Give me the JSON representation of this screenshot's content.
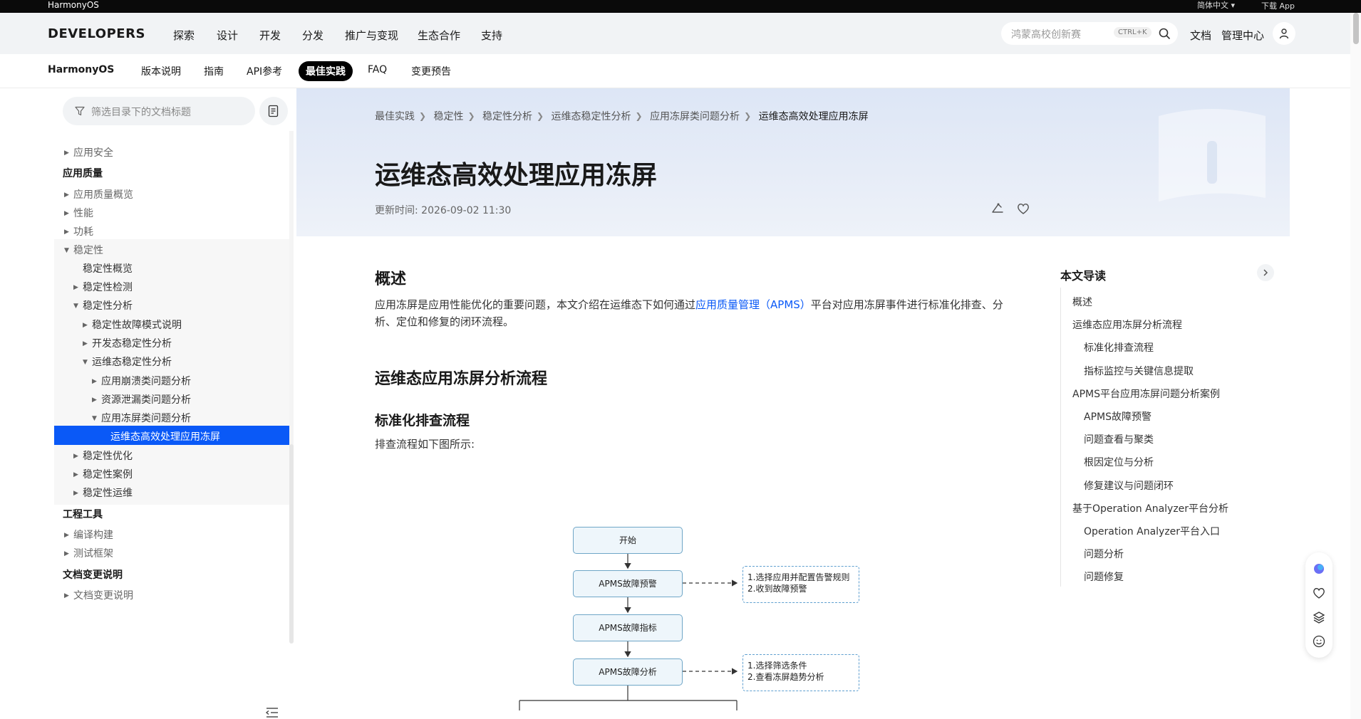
{
  "topbar": {
    "brand": "HarmonyOS",
    "language": "简体中文 ▾",
    "download": "下载 App"
  },
  "nav": {
    "logo": "DEVELOPERS",
    "items": [
      "探索",
      "设计",
      "开发",
      "分发",
      "推广与变现",
      "生态合作",
      "支持"
    ],
    "search": {
      "placeholder": "鸿蒙高校创新赛",
      "shortcut": "CTRL+K"
    },
    "right_links": [
      "文档",
      "管理中心"
    ]
  },
  "subnav": {
    "product": "HarmonyOS",
    "tabs": [
      "版本说明",
      "指南",
      "API参考",
      "最佳实践",
      "FAQ",
      "变更预告"
    ],
    "active_tab": "最佳实践"
  },
  "sidebar": {
    "filter_placeholder": "筛选目录下的文档标题",
    "items": [
      {
        "label": "应用安全",
        "type": "collapsed"
      },
      {
        "label": "应用质量",
        "type": "heading"
      },
      {
        "label": "应用质量概览",
        "type": "collapsed"
      },
      {
        "label": "性能",
        "type": "collapsed"
      },
      {
        "label": "功耗",
        "type": "collapsed"
      },
      {
        "label": "稳定性",
        "type": "expanded"
      },
      {
        "label": "稳定性概览",
        "type": "leaf"
      },
      {
        "label": "稳定性检测",
        "type": "collapsed"
      },
      {
        "label": "稳定性分析",
        "type": "expanded"
      },
      {
        "label": "稳定性故障模式说明",
        "type": "collapsed"
      },
      {
        "label": "开发态稳定性分析",
        "type": "collapsed"
      },
      {
        "label": "运维态稳定性分析",
        "type": "expanded"
      },
      {
        "label": "应用崩溃类问题分析",
        "type": "collapsed"
      },
      {
        "label": "资源泄漏类问题分析",
        "type": "collapsed"
      },
      {
        "label": "应用冻屏类问题分析",
        "type": "expanded"
      },
      {
        "label": "运维态高效处理应用冻屏",
        "type": "active"
      },
      {
        "label": "稳定性优化",
        "type": "collapsed"
      },
      {
        "label": "稳定性案例",
        "type": "collapsed"
      },
      {
        "label": "稳定性运维",
        "type": "collapsed"
      },
      {
        "label": "工程工具",
        "type": "heading"
      },
      {
        "label": "编译构建",
        "type": "collapsed"
      },
      {
        "label": "测试框架",
        "type": "collapsed"
      },
      {
        "label": "文档变更说明",
        "type": "heading"
      },
      {
        "label": "文档变更说明",
        "type": "collapsed"
      }
    ]
  },
  "article": {
    "breadcrumbs": [
      "最佳实践",
      "稳定性",
      "稳定性分析",
      "运维态稳定性分析",
      "应用冻屏类问题分析",
      "运维态高效处理应用冻屏"
    ],
    "title": "运维态高效处理应用冻屏",
    "updated": "更新时间: 2026-09-02 11:30",
    "overview_heading": "概述",
    "overview_text_before": "应用冻屏是应用性能优化的重要问题，本文介绍在运维态下如何通过",
    "overview_link": "应用质量管理（APMS）",
    "overview_text_after": "平台对应用冻屏事件进行标准化排查、分析、定位和修复的闭环流程。",
    "section_heading": "运维态应用冻屏分析流程",
    "sub_heading": "标准化排查流程",
    "flow_intro": "排查流程如下图所示:",
    "flow": {
      "nodes": [
        "开始",
        "APMS故障预警",
        "APMS故障指标",
        "APMS故障分析"
      ],
      "notes": [
        [
          "1.选择应用并配置告警规则",
          "2.收到故障预警"
        ],
        [
          "1.选择筛选条件",
          "2.查看冻屏趋势分析"
        ]
      ]
    }
  },
  "toc": {
    "title": "本文导读",
    "items": [
      {
        "label": "概述",
        "level": 1
      },
      {
        "label": "运维态应用冻屏分析流程",
        "level": 1
      },
      {
        "label": "标准化排查流程",
        "level": 2
      },
      {
        "label": "指标监控与关键信息提取",
        "level": 2
      },
      {
        "label": "APMS平台应用冻屏问题分析案例",
        "level": 1
      },
      {
        "label": "APMS故障预警",
        "level": 2
      },
      {
        "label": "问题查看与聚类",
        "level": 2
      },
      {
        "label": "根因定位与分析",
        "level": 2
      },
      {
        "label": "修复建议与问题闭环",
        "level": 2
      },
      {
        "label": "基于Operation Analyzer平台分析",
        "level": 1
      },
      {
        "label": "Operation Analyzer平台入口",
        "level": 2
      },
      {
        "label": "问题分析",
        "level": 2
      },
      {
        "label": "问题修复",
        "level": 2
      }
    ]
  },
  "colors": {
    "accent": "#0a59f7",
    "active_tab_bg": "#000000"
  }
}
